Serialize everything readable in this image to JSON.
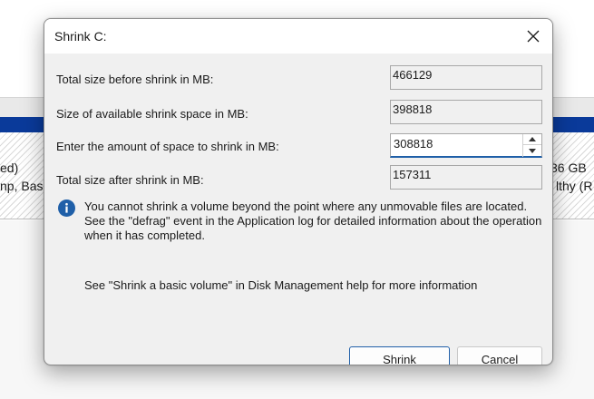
{
  "background": {
    "left_line1": "ed)",
    "left_line2": "np, Basi",
    "right_line1": "36 GB",
    "right_line2": "lthy (R"
  },
  "dialog": {
    "title": "Shrink C:",
    "close_icon": "close-icon",
    "fields": [
      {
        "label": "Total size before shrink in MB:",
        "value": "466129"
      },
      {
        "label": "Size of available shrink space in MB:",
        "value": "398818"
      },
      {
        "label": "Enter the amount of space to shrink in MB:",
        "value": "308818"
      },
      {
        "label": "Total size after shrink in MB:",
        "value": "157311"
      }
    ],
    "info": {
      "icon": "info-icon",
      "text": "You cannot shrink a volume beyond the point where any unmovable files are located. See the \"defrag\" event in the Application log for detailed information about the operation when it has completed."
    },
    "help_text": "See \"Shrink a basic volume\" in Disk Management help for more information",
    "buttons": {
      "shrink": "Shrink",
      "cancel": "Cancel"
    }
  },
  "colors": {
    "accent": "#1f5fa8",
    "disk_bar": "#0a3a9a",
    "dialog_bg": "#f0f0f0"
  }
}
